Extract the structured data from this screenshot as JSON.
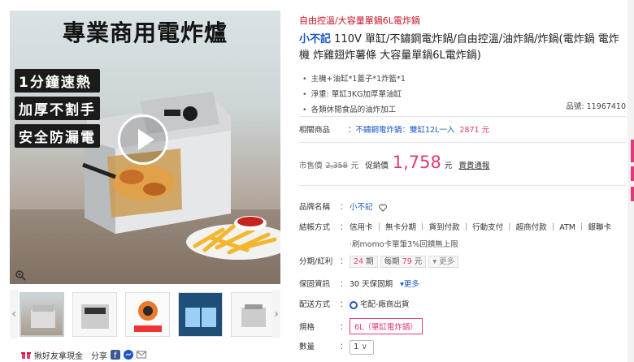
{
  "media": {
    "hero_title": "專業商用電炸爐",
    "badges": [
      "1分鐘速熱",
      "加厚不割手",
      "安全防漏電"
    ]
  },
  "share": {
    "invite_label": "揪好友拿現金",
    "share_label": "分享"
  },
  "product": {
    "breadcrumb": "自由控溫/大容量單鍋6L電炸鍋",
    "brand": "小不記",
    "title": " 110V 單缸/不鏽鋼電炸鍋/自由控溫/油炸鍋/炸鍋(電炸鍋 電炸機 炸雞翅炸薯條 大容量單鍋6L電炸鍋)",
    "bullets": [
      "主機+油缸*1蓋子*1炸籃*1",
      "淨重: 單缸3KG加厚單油缸",
      "各類休閒食品的油炸加工"
    ],
    "product_code_label": "品號: 11967410"
  },
  "related": {
    "label": "相關商品",
    "colon": "：",
    "link": "不鏽鋼電炸鍋：雙缸12L一入",
    "price": "2871 元"
  },
  "price": {
    "market_label": "市售價",
    "market_value": "2,358",
    "market_unit": "元",
    "sale_label": "促銷價",
    "sale_value": "1,758",
    "sale_unit": "元",
    "rules_link": "賣貴通報"
  },
  "specs": {
    "brand_label": "品牌名稱",
    "brand_value": "小不記",
    "payment_label": "結帳方式",
    "payment_value": "信用卡 ｜ 無卡分期 ｜ 貨到付款 ｜ 行動支付 ｜ 超商付款 ｜ ATM ｜ 銀聯卡",
    "payment_note": "‧刷momo卡單筆3%回饋無上限",
    "installment_label": "分期/紅利",
    "installment_periods": "24",
    "installment_period_unit": "期",
    "installment_monthly_label": "每期",
    "installment_monthly_value": "79",
    "installment_monthly_unit": "元",
    "installment_more": "更多",
    "warranty_label": "保固資訊",
    "warranty_value": "30 天保固期",
    "warranty_more": "更多",
    "delivery_label": "配送方式",
    "delivery_value": "宅配-廠商出貨",
    "size_label": "規格",
    "size_value": "6L（單缸電炸鍋）",
    "qty_label": "數量",
    "qty_value": "1"
  },
  "colors": {
    "accent_red": "#c8142a",
    "price_pink": "#e4387b",
    "link_blue": "#1a56c4"
  }
}
